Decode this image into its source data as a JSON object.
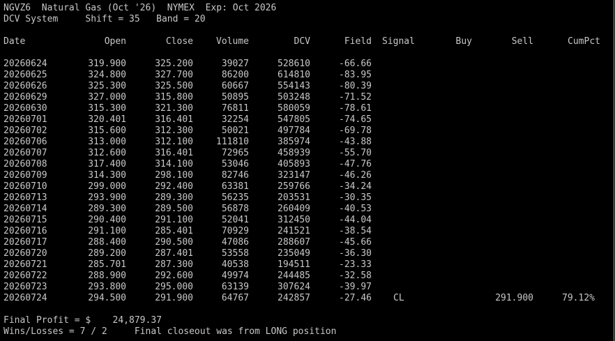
{
  "header": {
    "line1": "NGVZ6  Natural Gas (Oct '26)  NYMEX  Exp: Oct 2026",
    "line2": "DCV System     Shift = 35   Band = 20"
  },
  "columns": [
    "Date",
    "Open",
    "Close",
    "Volume",
    "DCV",
    "Field",
    "Signal",
    "Buy",
    "Sell",
    "CumPct"
  ],
  "rows": [
    [
      "20260624",
      "319.900",
      "325.200",
      "39027",
      "528610",
      "-66.66",
      "",
      "",
      "",
      ""
    ],
    [
      "20260625",
      "324.800",
      "327.700",
      "86200",
      "614810",
      "-83.95",
      "",
      "",
      "",
      ""
    ],
    [
      "20260626",
      "325.300",
      "325.500",
      "60667",
      "554143",
      "-80.39",
      "",
      "",
      "",
      ""
    ],
    [
      "20260629",
      "327.000",
      "315.800",
      "50895",
      "503248",
      "-71.52",
      "",
      "",
      "",
      ""
    ],
    [
      "20260630",
      "315.300",
      "321.300",
      "76811",
      "580059",
      "-78.61",
      "",
      "",
      "",
      ""
    ],
    [
      "20260701",
      "320.401",
      "316.401",
      "32254",
      "547805",
      "-74.65",
      "",
      "",
      "",
      ""
    ],
    [
      "20260702",
      "315.600",
      "312.300",
      "50021",
      "497784",
      "-69.78",
      "",
      "",
      "",
      ""
    ],
    [
      "20260706",
      "313.000",
      "312.100",
      "111810",
      "385974",
      "-43.88",
      "",
      "",
      "",
      ""
    ],
    [
      "20260707",
      "312.600",
      "316.401",
      "72965",
      "458939",
      "-55.70",
      "",
      "",
      "",
      ""
    ],
    [
      "20260708",
      "317.400",
      "314.100",
      "53046",
      "405893",
      "-47.76",
      "",
      "",
      "",
      ""
    ],
    [
      "20260709",
      "314.300",
      "298.100",
      "82746",
      "323147",
      "-46.26",
      "",
      "",
      "",
      ""
    ],
    [
      "20260710",
      "299.000",
      "292.400",
      "63381",
      "259766",
      "-34.24",
      "",
      "",
      "",
      ""
    ],
    [
      "20260713",
      "293.900",
      "289.300",
      "56235",
      "203531",
      "-30.35",
      "",
      "",
      "",
      ""
    ],
    [
      "20260714",
      "289.300",
      "289.500",
      "56878",
      "260409",
      "-40.53",
      "",
      "",
      "",
      ""
    ],
    [
      "20260715",
      "290.400",
      "291.100",
      "52041",
      "312450",
      "-44.04",
      "",
      "",
      "",
      ""
    ],
    [
      "20260716",
      "291.100",
      "285.401",
      "70929",
      "241521",
      "-38.54",
      "",
      "",
      "",
      ""
    ],
    [
      "20260717",
      "288.400",
      "290.500",
      "47086",
      "288607",
      "-45.66",
      "",
      "",
      "",
      ""
    ],
    [
      "20260720",
      "289.200",
      "287.401",
      "53558",
      "235049",
      "-36.30",
      "",
      "",
      "",
      ""
    ],
    [
      "20260721",
      "285.701",
      "287.300",
      "40538",
      "194511",
      "-23.33",
      "",
      "",
      "",
      ""
    ],
    [
      "20260722",
      "288.900",
      "292.600",
      "49974",
      "244485",
      "-32.58",
      "",
      "",
      "",
      ""
    ],
    [
      "20260723",
      "293.800",
      "295.000",
      "63139",
      "307624",
      "-39.97",
      "",
      "",
      "",
      ""
    ],
    [
      "20260724",
      "294.500",
      "291.900",
      "64767",
      "242857",
      "-27.46",
      "CL",
      "",
      "291.900",
      "79.12%"
    ]
  ],
  "footer": {
    "profit": "Final Profit = $    24,879.37",
    "winloss": "Wins/Losses = 7 / 2     Final closeout was from LONG position"
  },
  "colors": {
    "background": "#000000",
    "text": "#c8c8c8"
  }
}
